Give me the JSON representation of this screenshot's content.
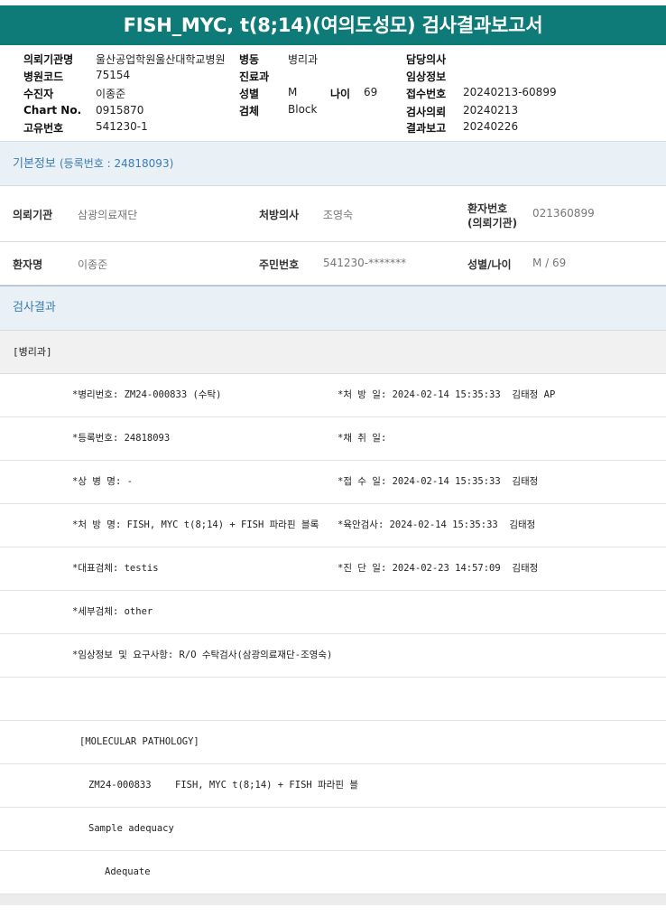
{
  "title": "FISH_MYC, t(8;14)(여의도성모) 검사결과보고서",
  "header": {
    "col1": [
      {
        "label": "의뢰기관명",
        "value": "울산공업학원울산대학교병원"
      },
      {
        "label": "병원코드",
        "value": "75154"
      },
      {
        "label": "수진자",
        "value": "이종준"
      },
      {
        "label": "Chart No.",
        "value": "0915870"
      },
      {
        "label": "고유번호",
        "value": "541230-1"
      }
    ],
    "col2": [
      {
        "label": "병동",
        "value": "병리과"
      },
      {
        "label": "진료과",
        "value": ""
      },
      {
        "label": "성별",
        "value": "M"
      },
      {
        "label": "검체",
        "value": "Block"
      }
    ],
    "age": {
      "label": "나이",
      "value": "69"
    },
    "col3": [
      {
        "label": "담당의사",
        "value": ""
      },
      {
        "label": "임상정보",
        "value": ""
      },
      {
        "label": "접수번호",
        "value": "20240213-60899"
      },
      {
        "label": "검사의뢰",
        "value": "20240213"
      },
      {
        "label": "결과보고",
        "value": "20240226"
      }
    ]
  },
  "basic_info": {
    "title": "기본정보",
    "reg_note": "(등록번호 : 24818093)",
    "row1": {
      "institution_label": "의뢰기관",
      "institution_value": "삼광의료재단",
      "doctor_label": "처방의사",
      "doctor_value": "조영숙",
      "patient_no_label_1": "환자번호",
      "patient_no_label_2": "(의뢰기관)",
      "patient_no_value": "021360899"
    },
    "row2": {
      "name_label": "환자명",
      "name_value": "이종준",
      "rrn_label": "주민번호",
      "rrn_value": "541230-*******",
      "sexage_label": "성별/나이",
      "sexage_value": "M / 69"
    }
  },
  "results": {
    "title": "검사결과",
    "dept": "[병리과]",
    "rows": [
      {
        "left": "*병리번호: ZM24-000833 (수탁)",
        "right": "*처 방 일: 2024-02-14 15:35:33  김태정 AP"
      },
      {
        "left": "*등록번호: 24818093",
        "right": "*채 취 일:"
      },
      {
        "left": "*상 병 명: -",
        "right": "*접 수 일: 2024-02-14 15:35:33  김태정"
      },
      {
        "left": "*처 방 명: FISH, MYC t(8;14) + FISH 파라핀 블록",
        "right": "*육안검사: 2024-02-14 15:35:33  김태정"
      },
      {
        "left": "*대표검체: testis",
        "right": "*진 단 일: 2024-02-23 14:57:09  김태정"
      },
      {
        "left": "*세부검체: other",
        "right": ""
      },
      {
        "left": "*임상정보 및 요구사항: R/O 수탁검사(삼광의료재단-조영숙)",
        "right": ""
      }
    ],
    "molecular": "[MOLECULAR PATHOLOGY]",
    "order_no": "ZM24-000833",
    "order_name": "FISH, MYC t(8;14) + FISH 파라핀 블",
    "adequacy_label": "Sample adequacy",
    "adequacy_value": "Adequate"
  }
}
